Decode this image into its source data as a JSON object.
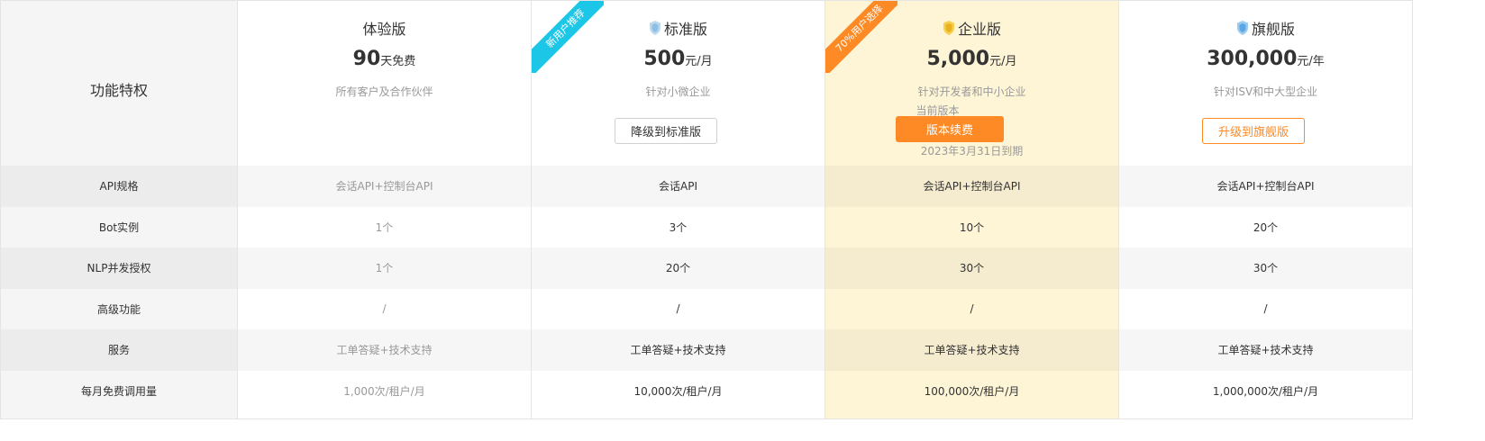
{
  "features": {
    "header": "功能特权",
    "rows": [
      "API规格",
      "Bot实例",
      "NLP并发授权",
      "高级功能",
      "服务",
      "每月免费调用量"
    ]
  },
  "plans": [
    {
      "name": "体验版",
      "price": "90",
      "unit": "天免费",
      "desc": "所有客户及合作伙伴",
      "values": [
        "会话API+控制台API",
        "1个",
        "1个",
        "/",
        "工单答疑+技术支持",
        "1,000次/租户/月"
      ]
    },
    {
      "name": "标准版",
      "icon": "shield-blue-icon",
      "ribbon": "新用户推荐",
      "price": "500",
      "unit": "元/月",
      "desc": "针对小微企业",
      "button": "降级到标准版",
      "values": [
        "会话API",
        "3个",
        "20个",
        "/",
        "工单答疑+技术支持",
        "10,000次/租户/月"
      ]
    },
    {
      "name": "企业版",
      "icon": "shield-gold-icon",
      "ribbon": "70%用户选择",
      "price": "5,000",
      "unit": "元/月",
      "desc": "针对开发者和中小企业",
      "note": "当前版本",
      "button": "版本续费",
      "expiry": "2023年3月31日到期",
      "values": [
        "会话API+控制台API",
        "10个",
        "30个",
        "/",
        "工单答疑+技术支持",
        "100,000次/租户/月"
      ]
    },
    {
      "name": "旗舰版",
      "icon": "shield-blue-icon",
      "price": "300,000",
      "unit": "元/年",
      "desc": "针对ISV和中大型企业",
      "button": "升级到旗舰版",
      "values": [
        "会话API+控制台API",
        "20个",
        "30个",
        "/",
        "工单答疑+技术支持",
        "1,000,000次/租户/月"
      ]
    }
  ],
  "colors": {
    "accent": "#fd8a25",
    "ribbon_blue": "#1cc6e6",
    "current_bg": "#fef4d6"
  }
}
